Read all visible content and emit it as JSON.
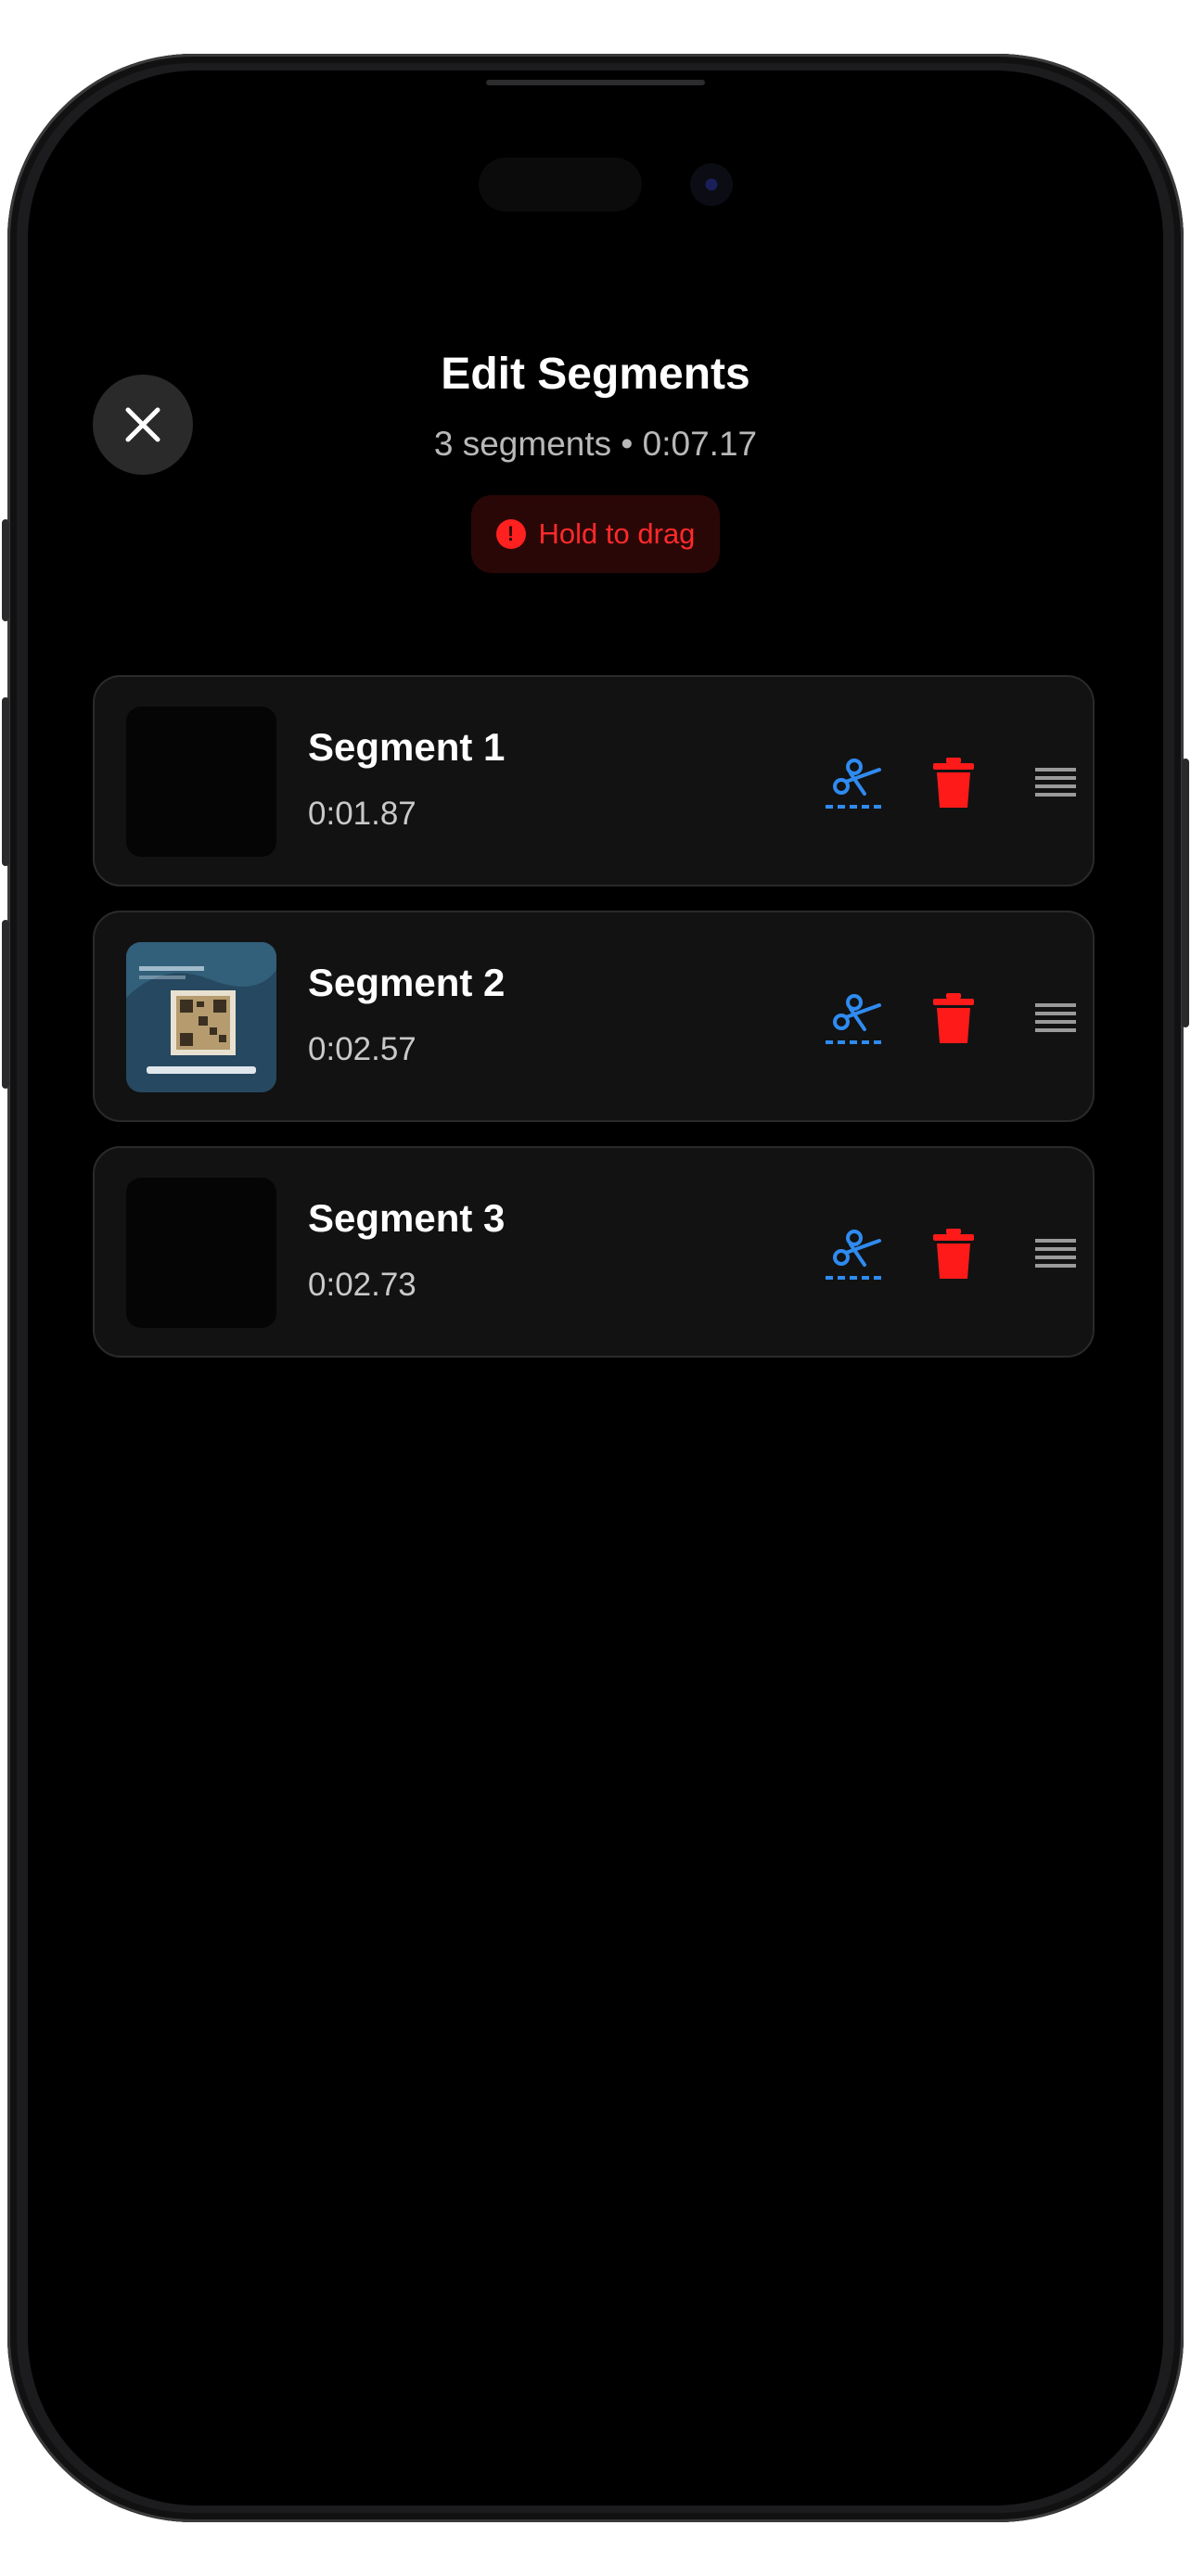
{
  "header": {
    "title": "Edit Segments",
    "subtitle": "3 segments • 0:07.17",
    "hint": "Hold to drag"
  },
  "segments": [
    {
      "name": "Segment 1",
      "duration": "0:01.87",
      "thumbnail": "dark"
    },
    {
      "name": "Segment 2",
      "duration": "0:02.57",
      "thumbnail": "qr-code-screen"
    },
    {
      "name": "Segment 3",
      "duration": "0:02.73",
      "thumbnail": "dark"
    }
  ],
  "icons": {
    "close": "close-icon",
    "trim": "scissors-icon",
    "delete": "trash-icon",
    "drag": "drag-handle-icon",
    "info": "info-icon"
  },
  "colors": {
    "background": "#000000",
    "trim_accent": "#2f8bf0",
    "delete_accent": "#ff1a1a",
    "hint_bg": "#2a0707",
    "hint_text": "#ff2a2a",
    "card_bg": "#121212"
  }
}
